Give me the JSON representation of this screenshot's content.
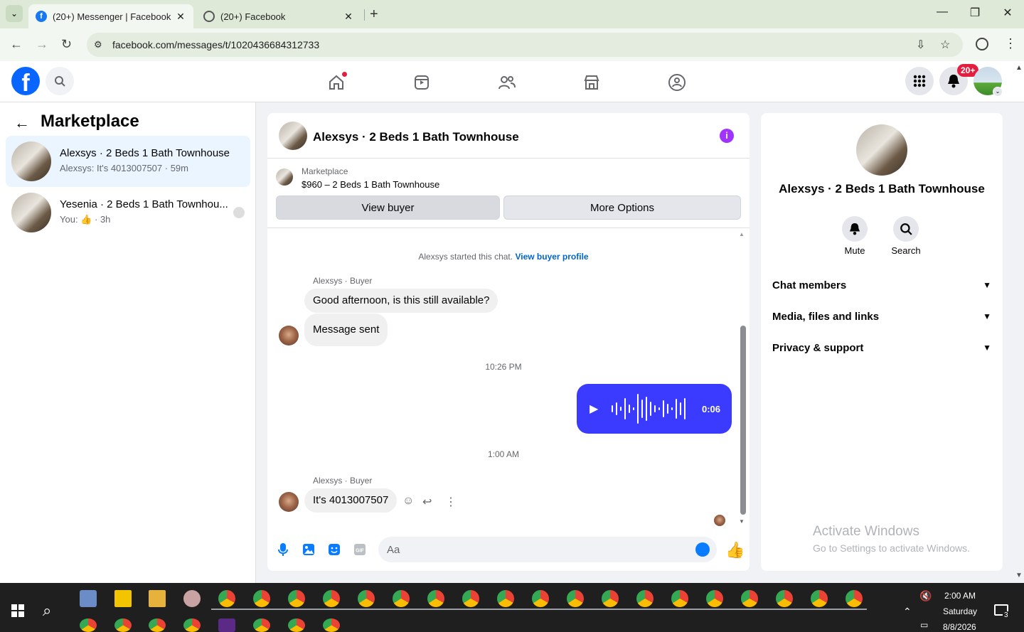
{
  "browser": {
    "tabs": [
      {
        "title": "(20+) Messenger | Facebook",
        "active": true
      },
      {
        "title": "(20+) Facebook",
        "active": false
      }
    ],
    "url": "facebook.com/messages/t/1020436684312733"
  },
  "fb_nav": {
    "notification_badge": "20+"
  },
  "sidebar": {
    "title": "Marketplace",
    "conversations": [
      {
        "name": "Alexsys · 2 Beds 1 Bath Townhouse",
        "preview": "Alexsys: It's 4013007507",
        "time": "59m",
        "selected": true
      },
      {
        "name": "Yesenia · 2 Beds 1 Bath Townhou...",
        "preview": "You:",
        "time": "3h",
        "selected": false
      }
    ]
  },
  "chat": {
    "title": "Alexsys · 2 Beds 1 Bath Townhouse",
    "listing_source": "Marketplace",
    "listing": "$960 – 2 Beds 1 Bath Townhouse",
    "view_buyer": "View buyer",
    "more_options": "More Options",
    "system_text": "Alexsys started this chat.",
    "system_link": "View buyer profile",
    "sender_label": "Alexsys · Buyer",
    "messages": {
      "m1": "Good afternoon, is this still available?",
      "m2": "Message sent",
      "ts1": "10:26 PM",
      "voice_duration": "0:06",
      "ts2": "1:00 AM",
      "m3": "It's 4013007507"
    },
    "composer_placeholder": "Aa"
  },
  "right_panel": {
    "name": "Alexsys · 2 Beds 1 Bath Townhouse",
    "mute": "Mute",
    "search": "Search",
    "sections": [
      "Chat members",
      "Media, files and links",
      "Privacy & support"
    ]
  },
  "watermark": {
    "line1": "Activate Windows",
    "line2": "Go to Settings to activate Windows."
  },
  "taskbar": {
    "time": "2:00 AM",
    "day": "Saturday",
    "date": "8/8/2026",
    "notification_count": "3"
  }
}
